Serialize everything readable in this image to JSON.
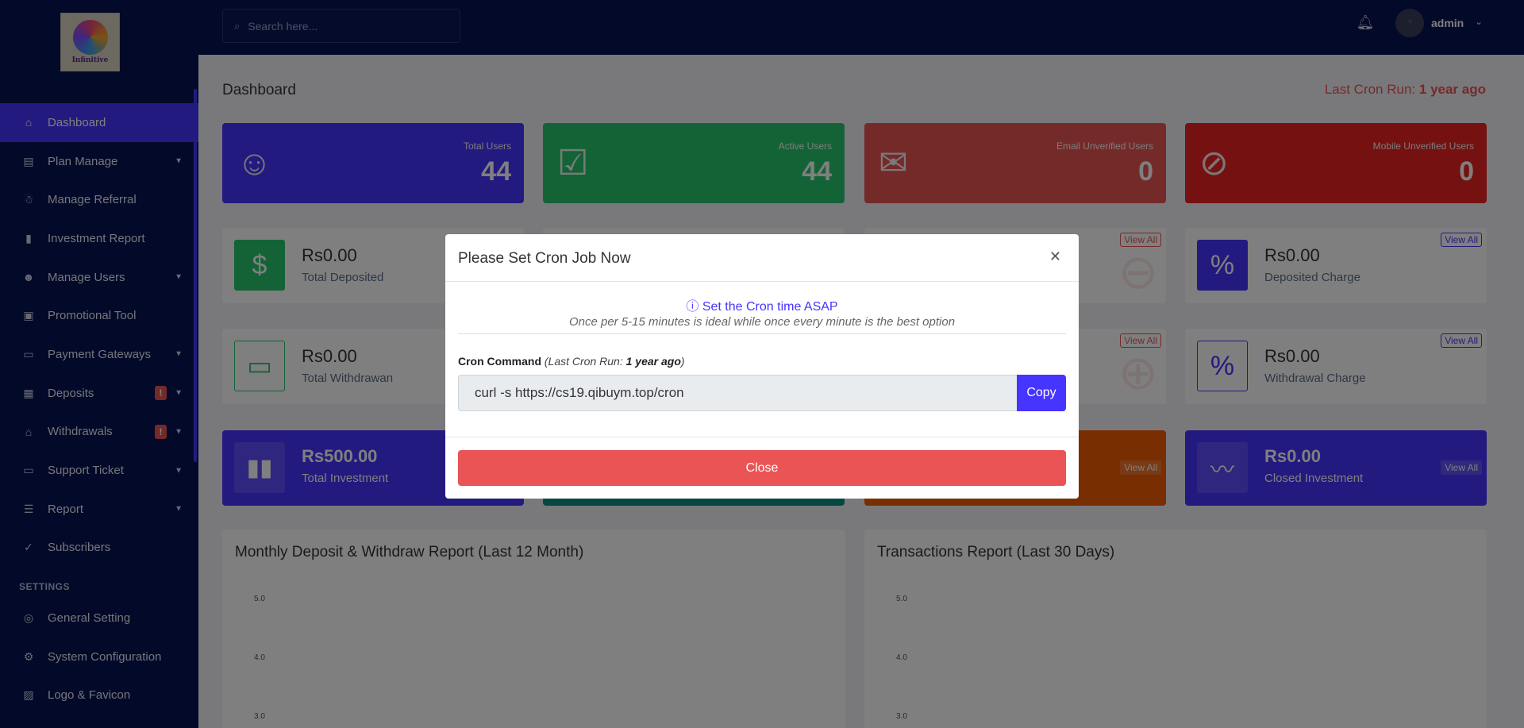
{
  "brand": {
    "logo_text": "Infinitive"
  },
  "search": {
    "placeholder": "Search here..."
  },
  "user": {
    "name": "admin",
    "avatar_text": "?"
  },
  "sidebar": {
    "items": [
      {
        "label": "Dashboard",
        "icon": "home-icon",
        "active": true
      },
      {
        "label": "Plan Manage",
        "icon": "clipboard-icon"
      },
      {
        "label": "Manage Referral",
        "icon": "user-referral-icon"
      },
      {
        "label": "Investment Report",
        "icon": "bar-chart-icon"
      },
      {
        "label": "Manage Users",
        "icon": "users-icon"
      },
      {
        "label": "Promotional Tool",
        "icon": "ad-icon"
      },
      {
        "label": "Payment Gateways",
        "icon": "credit-card-icon"
      },
      {
        "label": "Deposits",
        "icon": "deposit-icon",
        "alert": "!"
      },
      {
        "label": "Withdrawals",
        "icon": "bank-icon",
        "alert": "!"
      },
      {
        "label": "Support Ticket",
        "icon": "ticket-icon"
      },
      {
        "label": "Report",
        "icon": "list-icon"
      },
      {
        "label": "Subscribers",
        "icon": "thumbs-up-icon"
      }
    ],
    "settings_heading": "SETTINGS",
    "settings_items": [
      {
        "label": "General Setting",
        "icon": "life-ring-icon"
      },
      {
        "label": "System Configuration",
        "icon": "gear-icon"
      },
      {
        "label": "Logo & Favicon",
        "icon": "image-icon"
      }
    ]
  },
  "page": {
    "title": "Dashboard",
    "cron_prefix": "Last Cron Run:",
    "cron_value": "1 year ago"
  },
  "stats": [
    {
      "label": "Total Users",
      "value": "44",
      "color": "#4634ff",
      "icon": "users-group-icon"
    },
    {
      "label": "Active Users",
      "value": "44",
      "color": "#28c76f",
      "icon": "user-check-icon"
    },
    {
      "label": "Email Unverified Users",
      "value": "0",
      "color": "#ea5455",
      "icon": "envelope-icon"
    },
    {
      "label": "Mobile Unverified Users",
      "value": "0",
      "color": "#eb2222",
      "icon": "message-slash-icon"
    }
  ],
  "widgets_row1": [
    {
      "amount": "Rs0.00",
      "label": "Total Deposited",
      "icon": "hand-dollar-icon",
      "view_all": "View All"
    },
    {
      "amount": "Rs0.00",
      "label": "Deposited Charge",
      "icon": "percent-icon",
      "view_all": "View All"
    }
  ],
  "widgets_row2": [
    {
      "amount": "Rs0.00",
      "label": "Total Withdrawan",
      "icon": "card-icon",
      "view_all": "View All"
    },
    {
      "amount": "Rs0.00",
      "label": "Withdrawal Charge",
      "icon": "percent-outline-icon",
      "view_all": "View All"
    }
  ],
  "widgets_row3": [
    {
      "amount": "Rs500.00",
      "label": "Total Investment",
      "icon": "bar-chart-icon",
      "view_all": "View All"
    },
    {
      "amount": "Rs0.00",
      "label": "Closed Investment",
      "icon": "wave-icon",
      "view_all": "View All"
    }
  ],
  "charts": [
    {
      "title": "Monthly Deposit & Withdraw Report (Last 12 Month)",
      "ticks": [
        "5.0",
        "4.0",
        "3.0"
      ]
    },
    {
      "title": "Transactions Report (Last 30 Days)",
      "ticks": [
        "5.0",
        "4.0",
        "3.0"
      ]
    }
  ],
  "modal": {
    "title": "Please Set Cron Job Now",
    "notice_title": "Set the Cron time ASAP",
    "notice_text": "Once per 5-15 minutes is ideal while once every minute is the best option",
    "cmd_label": "Cron Command",
    "cmd_cron_prefix": "(Last Cron Run:",
    "cmd_cron_value": "1 year ago",
    "cmd_cron_suffix": ")",
    "cmd_value": "curl -s https://cs19.qibuym.top/cron",
    "copy_label": "Copy",
    "close_label": "Close"
  }
}
